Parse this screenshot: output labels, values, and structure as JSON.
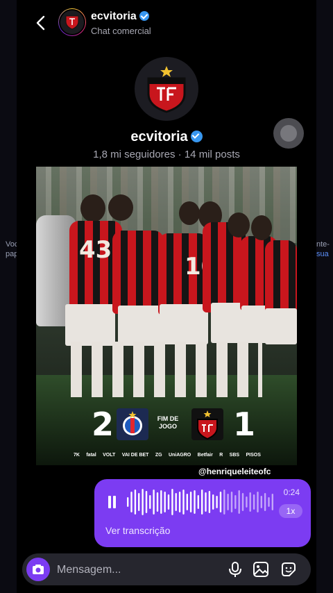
{
  "header": {
    "username": "ecvitoria",
    "subtitle": "Chat comercial"
  },
  "profile": {
    "name": "ecvitoria",
    "stats": "1,8 mi seguidores · 14 mil posts"
  },
  "post": {
    "home_score": "2",
    "away_score": "1",
    "status_line1": "FIM DE",
    "status_line2": "JOGO",
    "jersey_numbers": [
      "43",
      "10"
    ],
    "sponsors": [
      "7K",
      "fatal",
      "VOLT",
      "VAI DE BET",
      "ZG",
      "UniAGRO",
      "Betfair",
      "R",
      "SBS",
      "PISOS"
    ],
    "watermark": "@henriqueleiteofc"
  },
  "voice_message": {
    "duration": "0:24",
    "speed": "1x",
    "transcription_link": "Ver transcrição",
    "color": "#7c3cf2"
  },
  "composer": {
    "placeholder": "Mensagem..."
  },
  "background_ghost": {
    "left_text": "Voc",
    "left_text2": "pap",
    "right_text": "nte-",
    "right_text2": "sua"
  },
  "colors": {
    "accent": "#7c3cf2",
    "verified": "#3897f0",
    "club_red": "#c8161d"
  },
  "icons": [
    "back-arrow-icon",
    "verified-icon",
    "camera-icon",
    "microphone-icon",
    "gallery-icon",
    "sticker-icon",
    "pause-icon"
  ]
}
